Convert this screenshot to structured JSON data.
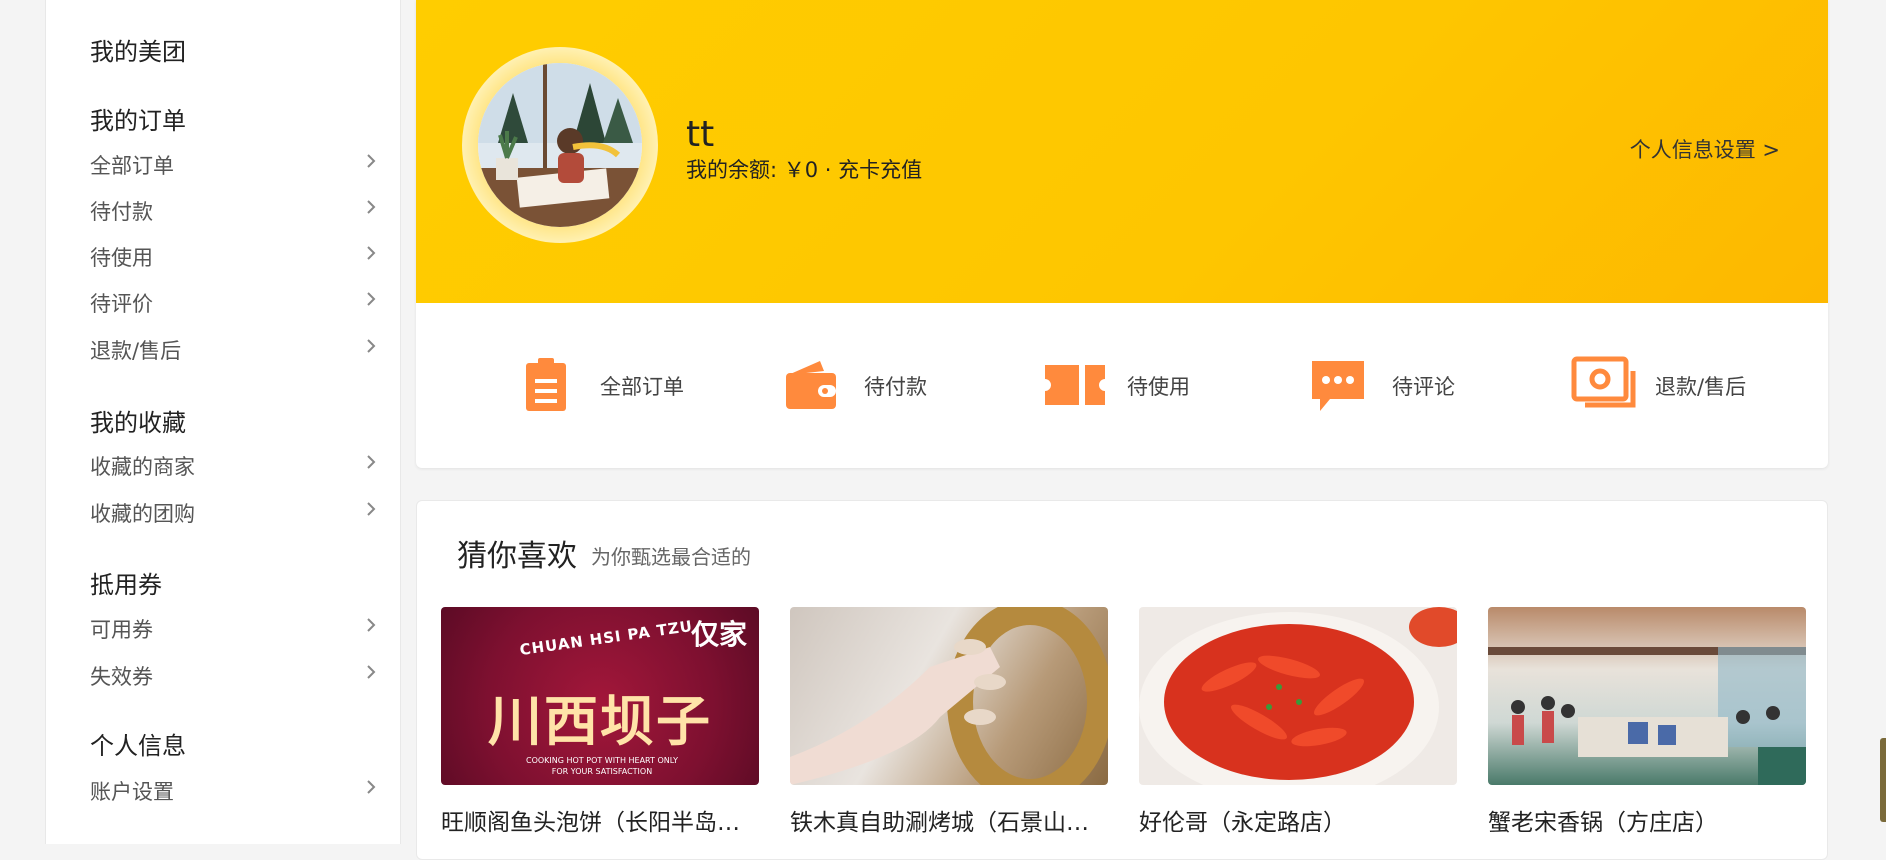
{
  "sidebar": {
    "title": "我的美团",
    "sections": [
      {
        "heading": "我的订单",
        "items": [
          "全部订单",
          "待付款",
          "待使用",
          "待评价",
          "退款/售后"
        ]
      },
      {
        "heading": "我的收藏",
        "items": [
          "收藏的商家",
          "收藏的团购"
        ]
      },
      {
        "heading": "抵用券",
        "items": [
          "可用券",
          "失效券"
        ]
      },
      {
        "heading": "个人信息",
        "items": [
          "账户设置"
        ]
      }
    ]
  },
  "profile": {
    "username": "tt",
    "balance_text": "我的余额: ￥0 · 充卡充值",
    "settings_link": "个人信息设置 >"
  },
  "orders": [
    {
      "label": "全部订单",
      "icon": "clipboard-icon"
    },
    {
      "label": "待付款",
      "icon": "wallet-icon"
    },
    {
      "label": "待使用",
      "icon": "ticket-icon"
    },
    {
      "label": "待评论",
      "icon": "chat-bubble-icon"
    },
    {
      "label": "退款/售后",
      "icon": "refund-icon"
    }
  ],
  "recommend": {
    "title": "猜你喜欢",
    "subtitle": "为你甄选最合适的",
    "items": [
      {
        "name": "旺顺阁鱼头泡饼（长阳半岛…",
        "img_text": "川西坝子",
        "img_top": "CHUAN HSI PA TZU",
        "img_badge": "仅家",
        "img_bottom": "COOKING HOT POT WITH HEART ONLY FOR YOUR SATISFACTION"
      },
      {
        "name": "铁木真自助涮烤城（石景山…"
      },
      {
        "name": "好伦哥（永定路店）"
      },
      {
        "name": "蟹老宋香锅（方庄店）"
      }
    ]
  },
  "colors": {
    "brand_yellow": "#ffcd00",
    "order_icon": "#ff8a3d"
  }
}
